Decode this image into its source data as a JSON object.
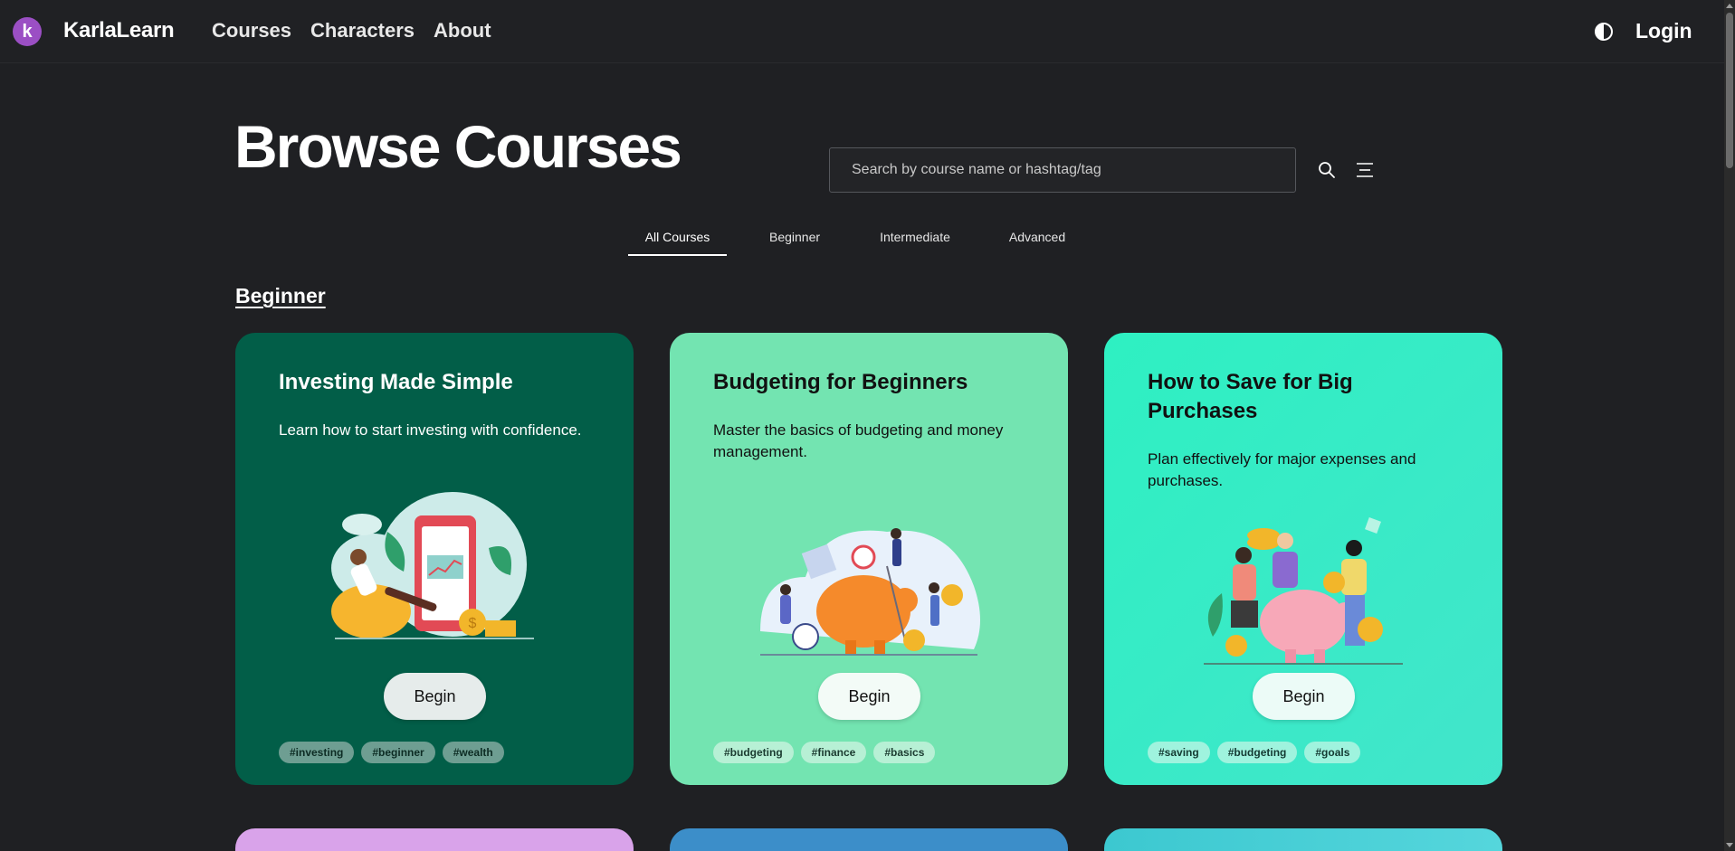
{
  "brand": {
    "logo_letter": "k",
    "name": "KarlaLearn",
    "logo_color": "#9b4fc4"
  },
  "nav": {
    "links": [
      "Courses",
      "Characters",
      "About"
    ],
    "login": "Login"
  },
  "header": {
    "title": "Browse Courses",
    "search_placeholder": "Search by course name or hashtag/tag"
  },
  "tabs": [
    "All Courses",
    "Beginner",
    "Intermediate",
    "Advanced"
  ],
  "active_tab": "All Courses",
  "section": {
    "heading": "Beginner"
  },
  "cards": [
    {
      "title": "Investing Made Simple",
      "description": "Learn how to start investing with confidence.",
      "button": "Begin",
      "tags": [
        "#investing",
        "#beginner",
        "#wealth"
      ],
      "color": "#025e48"
    },
    {
      "title": "Budgeting for Beginners",
      "description": "Master the basics of budgeting and money management.",
      "button": "Begin",
      "tags": [
        "#budgeting",
        "#finance",
        "#basics"
      ],
      "color": "#73e4b1"
    },
    {
      "title": "How to Save for Big Purchases",
      "description": "Plan effectively for major expenses and purchases.",
      "button": "Begin",
      "tags": [
        "#saving",
        "#budgeting",
        "#goals"
      ],
      "color": "#2ef0c2"
    }
  ],
  "icons": [
    "half-circle-theme-icon",
    "search-icon",
    "filter-lines-icon"
  ]
}
